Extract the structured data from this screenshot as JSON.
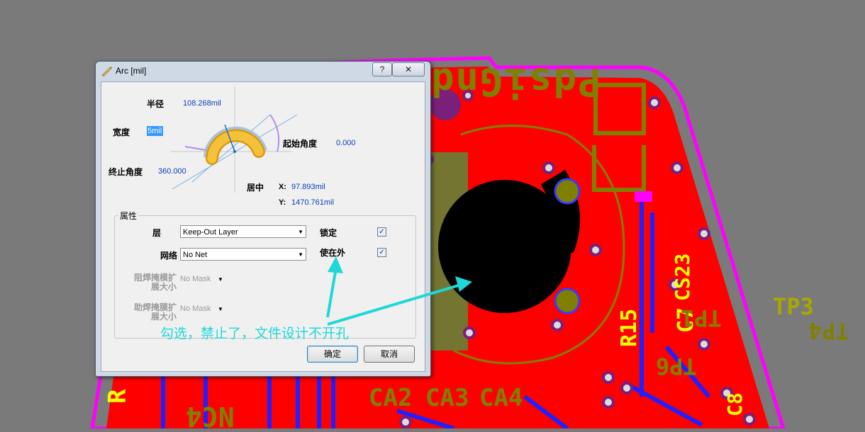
{
  "dialog": {
    "title": "Arc [mil]",
    "help_label": "?",
    "close_label": "✕",
    "radius_label": "半径",
    "radius_value": "108.268mil",
    "width_label": "宽度",
    "width_value": "5mil",
    "start_angle_label": "起始角度",
    "start_angle_value": "0.000",
    "end_angle_label": "终止角度",
    "end_angle_value": "360.000",
    "center_label": "居中",
    "x_label": "X:",
    "x_value": "97.893mil",
    "y_label": "Y:",
    "y_value": "1470.761mil",
    "properties_label": "属性",
    "layer_label": "层",
    "layer_value": "Keep-Out Layer",
    "net_label": "网络",
    "net_value": "No Net",
    "locked_label": "锁定",
    "keepout_label": "使在外",
    "solder_mask_label": "阻焊掩模扩展大小",
    "solder_mask_value": "No Mask",
    "paste_mask_label": "助焊掩膜扩展大小",
    "paste_mask_value": "No Mask",
    "ok_label": "确定",
    "cancel_label": "取消"
  },
  "annotation": "勾选，禁止了，文件设计不开孔",
  "pcb_labels": {
    "top_mirrored": "PdsiGnd",
    "tp3": "TP3",
    "tp4": "TP4",
    "r15": "R15",
    "c7": "C7",
    "tp1": "TP1",
    "c8": "C8",
    "tp6": "TP6",
    "ca2": "CA2",
    "ca3": "CA3",
    "ca4": "CA4",
    "nc4": "NC4",
    "cs23": "CS23",
    "r_left": "R"
  },
  "colors": {
    "board": "#ff0000",
    "outline": "#ff00ff",
    "silk": "#808000",
    "annotation": "#1fd7d8"
  }
}
